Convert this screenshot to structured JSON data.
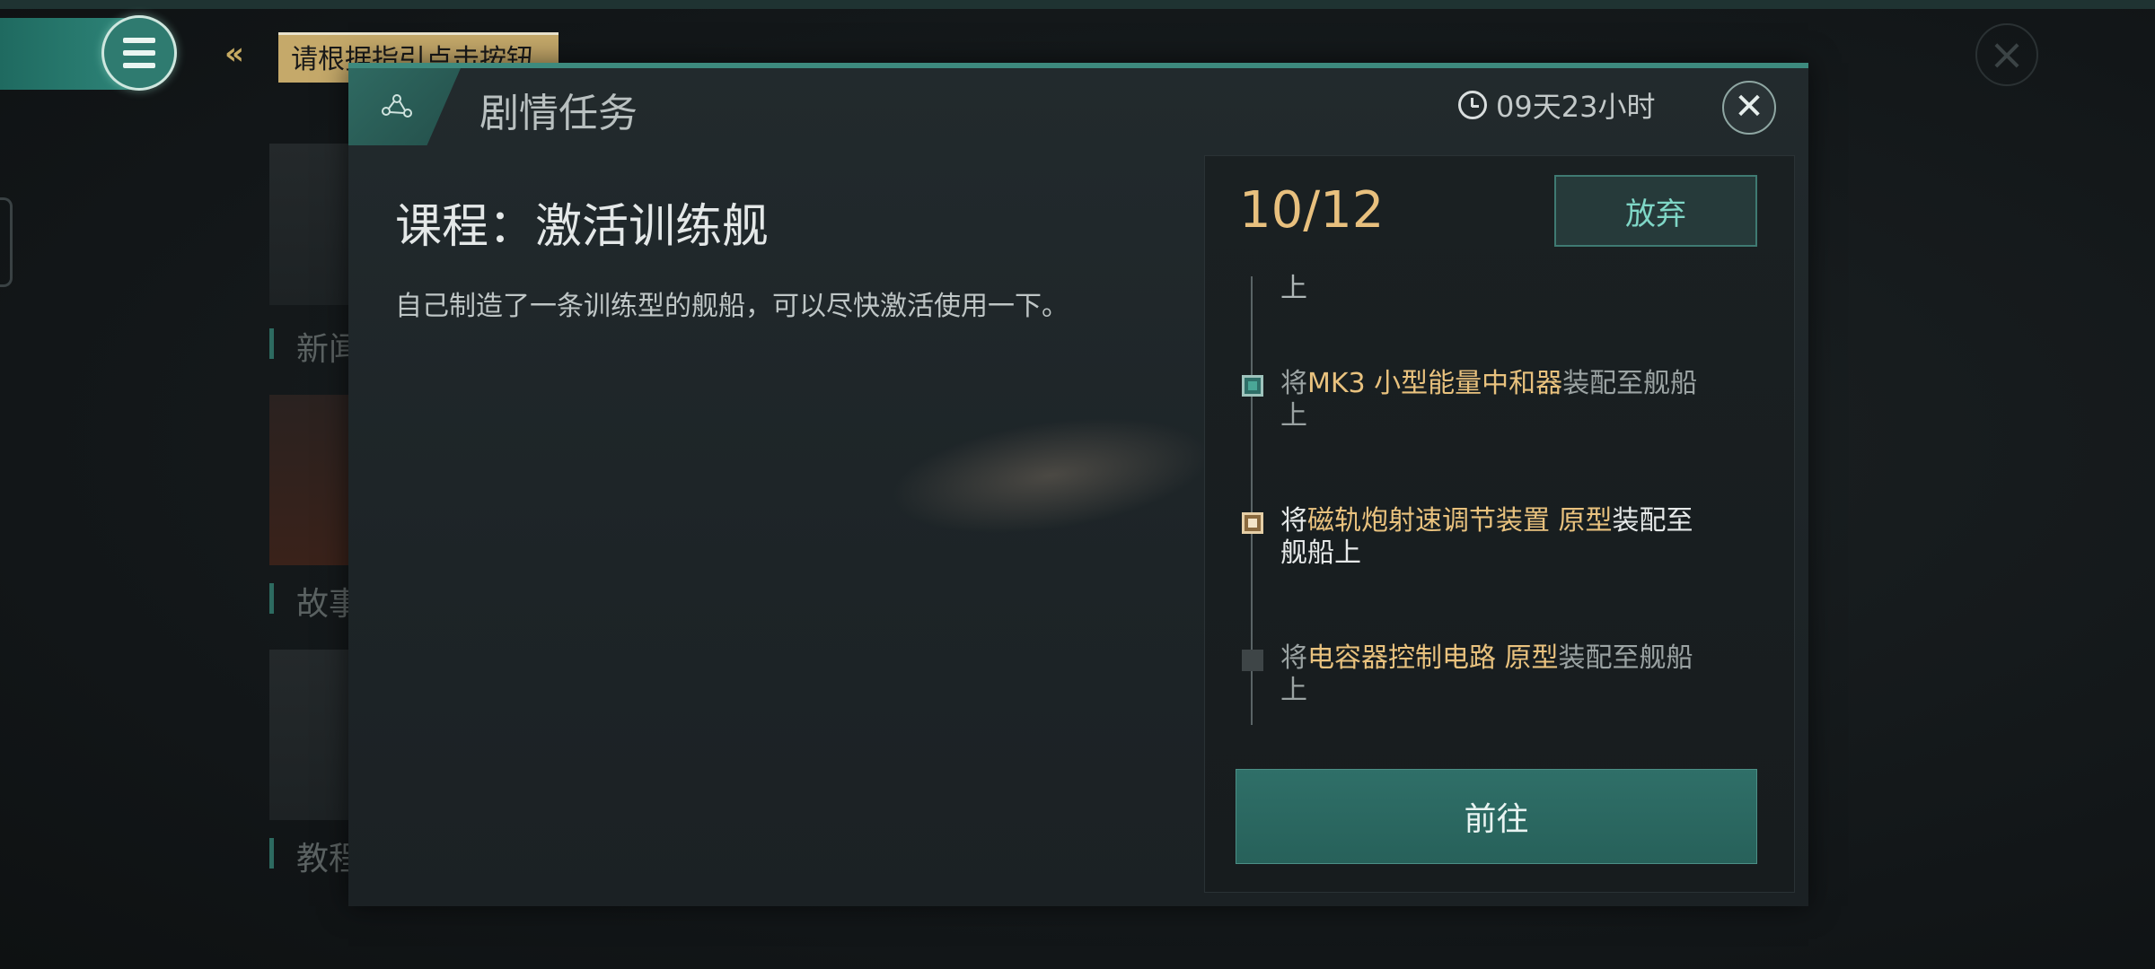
{
  "hud": {
    "menu_icon": "menu-icon",
    "guide_tip": "请根据指引点击按钮",
    "close_icon": "close-icon"
  },
  "side_list": {
    "items": [
      {
        "label": "新闻"
      },
      {
        "label": "故事"
      },
      {
        "label": "教程"
      }
    ]
  },
  "panel": {
    "title": "剧情任务",
    "timer": "09天23小时",
    "close_label": "✕"
  },
  "mission": {
    "title": "课程：激活训练舰",
    "description": "自己制造了一条训练型的舰船，可以尽快激活使用一下。"
  },
  "progress": {
    "text": "10/12",
    "abandon_label": "放弃"
  },
  "steps": {
    "fragment": "上",
    "items": [
      {
        "prefix": "将",
        "highlight": "MK3 小型能量中和器",
        "suffix": "装配至舰船上",
        "state": "done"
      },
      {
        "prefix": "将",
        "highlight": "磁轨炮射速调节装置 原型",
        "suffix": "装配至舰船上",
        "state": "current"
      },
      {
        "prefix": "将",
        "highlight": "电容器控制电路 原型",
        "suffix": "装配至舰船上",
        "state": "pending"
      }
    ]
  },
  "goto_label": "前往",
  "colors": {
    "accent_teal": "#2f6f68",
    "highlight_gold": "#e9c27e",
    "guide_tip_bg": "#c5a96a"
  }
}
